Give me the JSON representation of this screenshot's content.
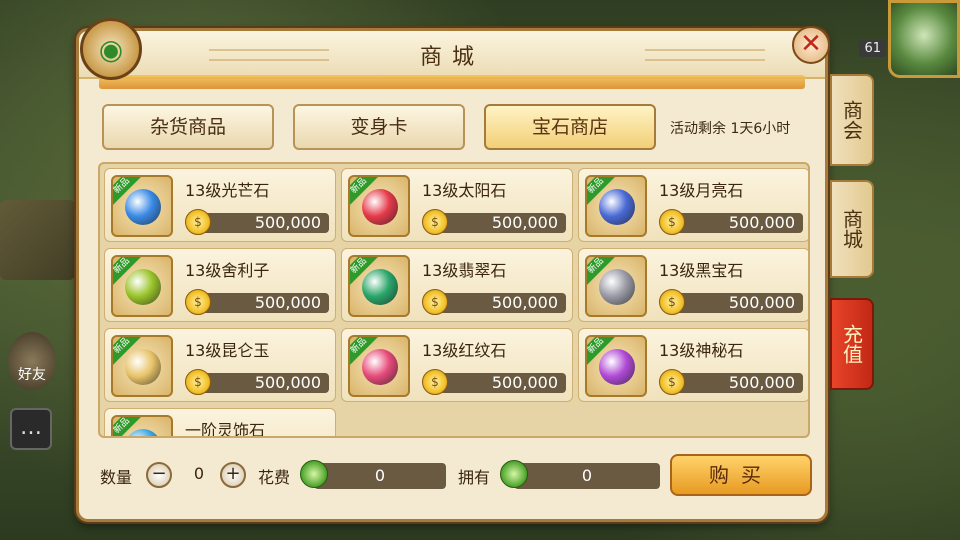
{
  "window": {
    "title": "商城"
  },
  "tabs": [
    {
      "label": "杂货商品",
      "active": false
    },
    {
      "label": "变身卡",
      "active": false
    },
    {
      "label": "宝石商店",
      "active": true
    }
  ],
  "activity_text": "活动剩余 1天6小时",
  "new_badge": "新品",
  "items": [
    {
      "name": "13级光芒石",
      "price": "500,000",
      "gem_color": "#3a8ae6",
      "icon": "blue-crystal-icon"
    },
    {
      "name": "13级太阳石",
      "price": "500,000",
      "gem_color": "#e63a4a",
      "icon": "sun-stone-icon"
    },
    {
      "name": "13级月亮石",
      "price": "500,000",
      "gem_color": "#4a6ad6",
      "icon": "moon-stone-icon"
    },
    {
      "name": "13级舍利子",
      "price": "500,000",
      "gem_color": "#9ac42a",
      "icon": "sarira-icon"
    },
    {
      "name": "13级翡翠石",
      "price": "500,000",
      "gem_color": "#2aa66a",
      "icon": "jade-stone-icon"
    },
    {
      "name": "13级黑宝石",
      "price": "500,000",
      "gem_color": "#9a9aa6",
      "icon": "black-gem-icon"
    },
    {
      "name": "13级昆仑玉",
      "price": "500,000",
      "gem_color": "#e8c46a",
      "icon": "kunlun-jade-icon"
    },
    {
      "name": "13级红纹石",
      "price": "500,000",
      "gem_color": "#e64a7a",
      "icon": "red-pattern-stone-icon"
    },
    {
      "name": "13级神秘石",
      "price": "500,000",
      "gem_color": "#b04ad6",
      "icon": "mystery-stone-icon"
    },
    {
      "name": "一阶灵饰石",
      "price": "",
      "gem_color": "#3aa6e6",
      "icon": "spirit-ornament-stone-icon"
    }
  ],
  "bottom": {
    "qty_label": "数量",
    "qty_minus": "−",
    "qty_value": "0",
    "qty_plus": "+",
    "cost_label": "花费",
    "cost_value": "0",
    "own_label": "拥有",
    "own_value": "0",
    "buy_label": "购买"
  },
  "side_tabs": [
    {
      "label": "商会"
    },
    {
      "label": "商城"
    },
    {
      "label": "充值"
    }
  ],
  "background": {
    "friend_label": "好友",
    "level": "61"
  }
}
